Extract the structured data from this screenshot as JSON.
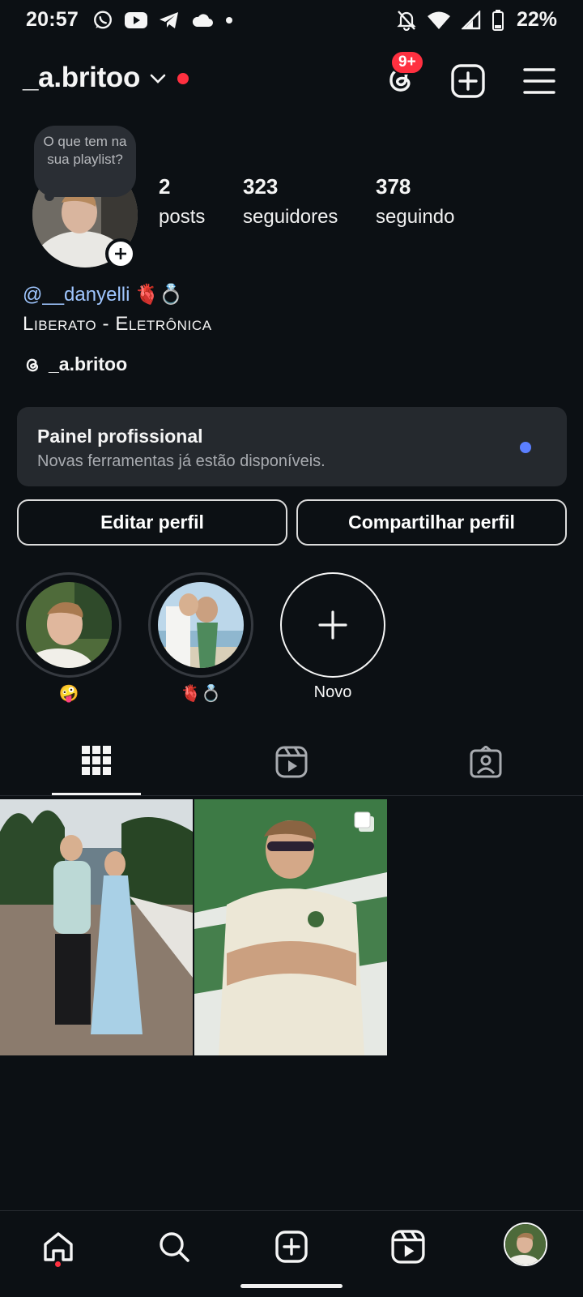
{
  "status_bar": {
    "time": "20:57",
    "battery": "22%",
    "left_icons": [
      "whatsapp-icon",
      "youtube-icon",
      "telegram-icon",
      "cloud-icon",
      "dot-icon"
    ],
    "right_icons": [
      "notifications-off-icon",
      "wifi-icon",
      "signal-icon",
      "battery-icon"
    ]
  },
  "header": {
    "username": "_a.britoo",
    "notification_badge": "9+"
  },
  "profile": {
    "note": "O que tem na sua playlist?",
    "stats": [
      {
        "value": "2",
        "label": "posts"
      },
      {
        "value": "323",
        "label": "seguidores"
      },
      {
        "value": "378",
        "label": "seguindo"
      }
    ],
    "mention": "@__danyelli",
    "mention_emoji": "🫀💍",
    "category": "Liberato - Eletrônica",
    "threads_handle": "_a.britoo"
  },
  "professional_panel": {
    "title": "Painel profissional",
    "subtitle": "Novas ferramentas já estão disponíveis."
  },
  "actions": {
    "edit": "Editar perfil",
    "share": "Compartilhar perfil"
  },
  "highlights": [
    {
      "label": "🤪"
    },
    {
      "label": "🫀💍"
    },
    {
      "label": "Novo"
    }
  ],
  "tabs": [
    "grid-icon",
    "reels-icon",
    "tagged-icon"
  ],
  "posts_count_visible": 2,
  "bottom_nav": [
    "home-icon",
    "search-icon",
    "create-icon",
    "reels-icon",
    "profile-avatar"
  ],
  "colors": {
    "background": "#0c1014",
    "badge": "#ff3040",
    "mention": "#9fc6ff",
    "panel": "#25292e",
    "pro_dot": "#5b7fff"
  }
}
